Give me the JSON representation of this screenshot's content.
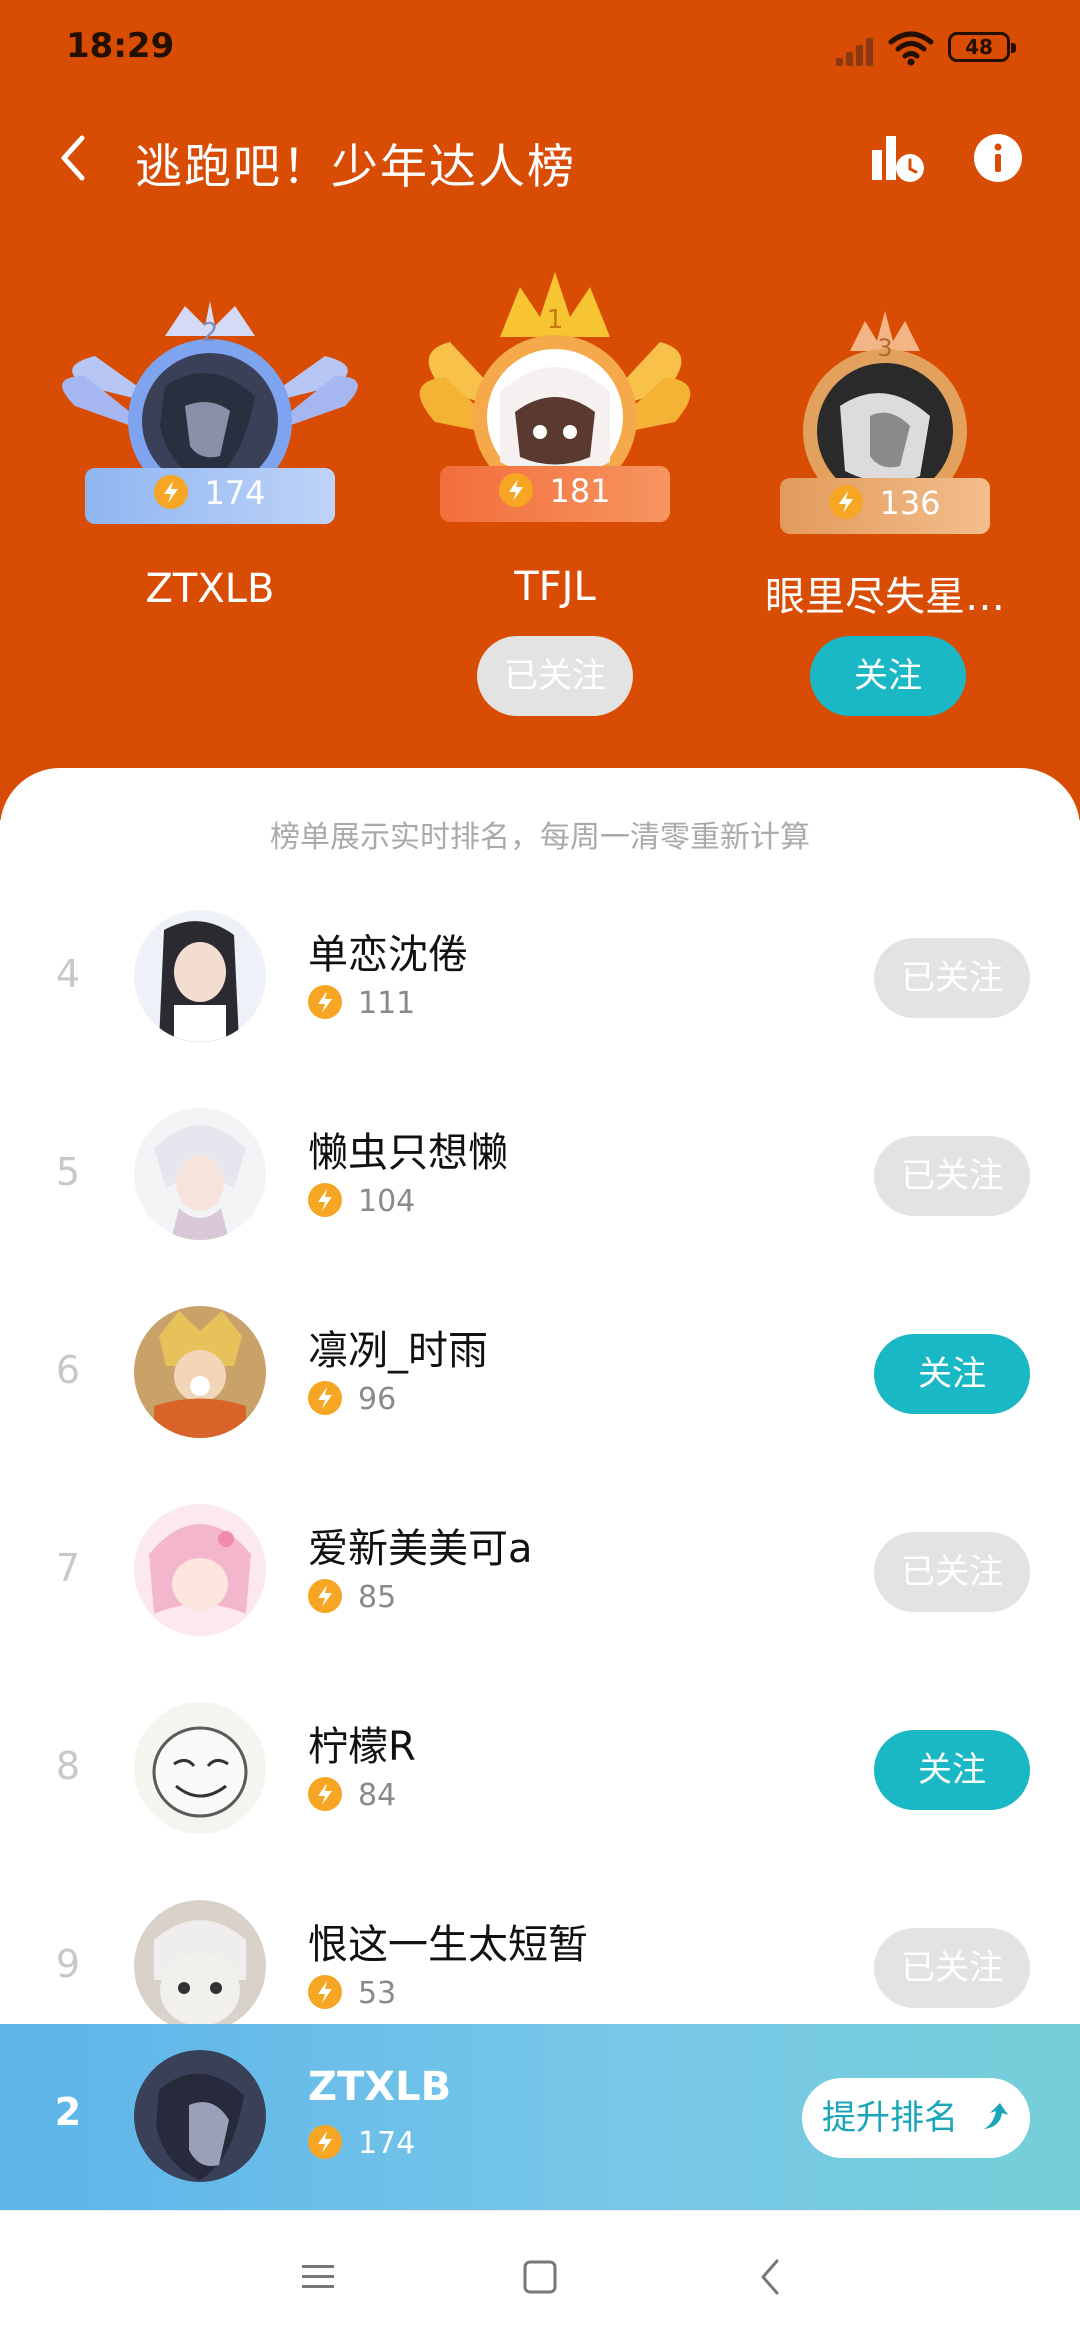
{
  "status": {
    "time": "18:29",
    "battery": "48"
  },
  "header": {
    "title": "逃跑吧！少年达人榜",
    "back_icon": "chevron-left-icon",
    "history_icon": "ranking-history-icon",
    "info_icon": "info-icon"
  },
  "podium": [
    {
      "rank": "2",
      "name": "ZTXLB",
      "score": "174",
      "follow": ""
    },
    {
      "rank": "1",
      "name": "TFJL",
      "score": "181",
      "follow": "已关注"
    },
    {
      "rank": "3",
      "name": "眼里尽失星…",
      "score": "136",
      "follow": "关注"
    }
  ],
  "notice": "榜单展示实时排名，每周一清零重新计算",
  "list": [
    {
      "rank": "4",
      "name": "单恋沈倦",
      "score": "111",
      "follow": "已关注",
      "followed": true
    },
    {
      "rank": "5",
      "name": "懒虫只想懒",
      "score": "104",
      "follow": "已关注",
      "followed": true
    },
    {
      "rank": "6",
      "name": "凛冽_时雨",
      "score": "96",
      "follow": "关注",
      "followed": false
    },
    {
      "rank": "7",
      "name": "爱新美美可a",
      "score": "85",
      "follow": "已关注",
      "followed": true
    },
    {
      "rank": "8",
      "name": "柠檬R",
      "score": "84",
      "follow": "关注",
      "followed": false
    },
    {
      "rank": "9",
      "name": "恨这一生太短暂",
      "score": "53",
      "follow": "已关注",
      "followed": true
    }
  ],
  "me": {
    "rank": "2",
    "name": "ZTXLB",
    "score": "174",
    "boost_label": "提升排名"
  },
  "colors": {
    "header_bg": "#D94C04",
    "follow": "#1AB8C4",
    "followed": "#e3e3e3",
    "bolt": "#F6A623"
  }
}
